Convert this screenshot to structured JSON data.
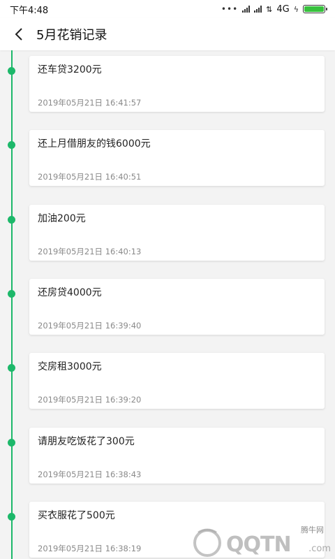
{
  "status_bar": {
    "time": "下午4:48",
    "dots": "•••",
    "network": "4G",
    "battery_level": 1.0
  },
  "header": {
    "back_icon": "chevron-left-icon",
    "title": "5月花销记录"
  },
  "accent_color": "#1db86a",
  "records": [
    {
      "text": "还车贷3200元",
      "time": "2019年05月21日 16:41:57"
    },
    {
      "text": "还上月借朋友的钱6000元",
      "time": "2019年05月21日 16:40:51"
    },
    {
      "text": "加油200元",
      "time": "2019年05月21日 16:40:13"
    },
    {
      "text": "还房贷4000元",
      "time": "2019年05月21日 16:39:40"
    },
    {
      "text": "交房租3000元",
      "time": "2019年05月21日 16:39:20"
    },
    {
      "text": "请朋友吃饭花了300元",
      "time": "2019年05月21日 16:38:43"
    },
    {
      "text": "买衣服花了500元",
      "time": "2019年05月21日 16:38:19"
    }
  ],
  "watermark": {
    "top_text": "腾牛网",
    "main_text": "QQTN",
    "suffix": ".com"
  }
}
